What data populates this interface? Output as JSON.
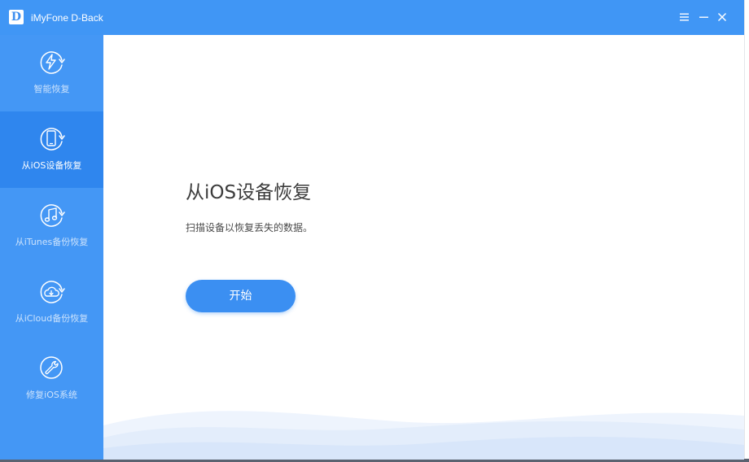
{
  "window": {
    "title": "iMyFone D-Back",
    "logo_letter": "D"
  },
  "colors": {
    "titlebar": "#4096f5",
    "sidebar": "#4497f5",
    "sidebar_active": "#2f86ee",
    "accent_button": "#3b8ff2"
  },
  "title_controls": [
    {
      "name": "menu",
      "icon": "menu-icon"
    },
    {
      "name": "minimize",
      "icon": "minimize-icon"
    },
    {
      "name": "close",
      "icon": "close-icon"
    }
  ],
  "sidebar": {
    "items": [
      {
        "label": "智能恢复",
        "icon": "lightning-refresh-icon",
        "active": false
      },
      {
        "label": "从iOS设备恢复",
        "icon": "phone-refresh-icon",
        "active": true
      },
      {
        "label": "从iTunes备份恢复",
        "icon": "music-note-refresh-icon",
        "active": false
      },
      {
        "label": "从iCloud备份恢复",
        "icon": "cloud-refresh-icon",
        "active": false
      },
      {
        "label": "修复iOS系统",
        "icon": "wrench-icon",
        "active": false
      }
    ]
  },
  "main": {
    "title": "从iOS设备恢复",
    "description": "扫描设备以恢复丢失的数据。",
    "start_label": "开始"
  }
}
